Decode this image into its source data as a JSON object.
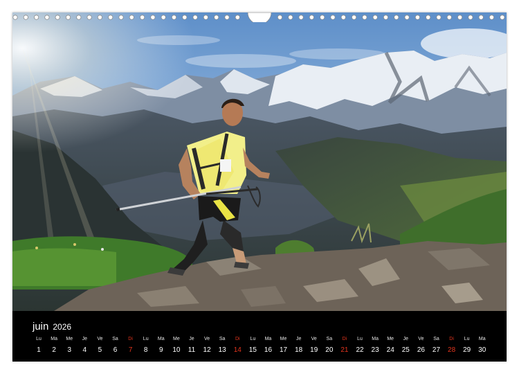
{
  "calendar": {
    "month": "juin",
    "year": "2026",
    "weekday_headers": [
      "Lu",
      "Ma",
      "Me",
      "Je",
      "Ve",
      "Sa",
      "Di",
      "Lu",
      "Ma",
      "Me",
      "Je",
      "Ve",
      "Sa",
      "Di",
      "Lu",
      "Ma",
      "Me",
      "Je",
      "Ve",
      "Sa",
      "Di",
      "Lu",
      "Ma",
      "Me",
      "Je",
      "Ve",
      "Sa",
      "Di",
      "Lu",
      "Ma"
    ],
    "days": [
      "1",
      "2",
      "3",
      "4",
      "5",
      "6",
      "7",
      "8",
      "9",
      "10",
      "11",
      "12",
      "13",
      "14",
      "15",
      "16",
      "17",
      "18",
      "19",
      "20",
      "21",
      "22",
      "23",
      "24",
      "25",
      "26",
      "27",
      "28",
      "29",
      "30"
    ],
    "sunday_color": "#e2341d"
  },
  "photo": {
    "subject": "trail runner with trekking poles on a rocky alpine ridge, snow-capped mountains and valley behind"
  }
}
